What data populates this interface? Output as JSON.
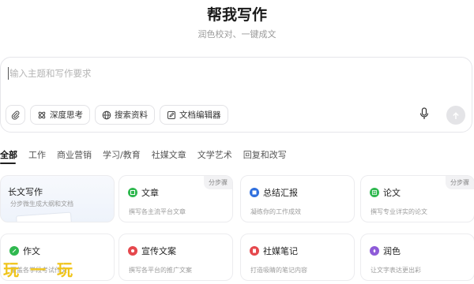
{
  "header": {
    "title": "帮我写作",
    "subtitle": "润色校对、一键成文"
  },
  "composer": {
    "placeholder": "输入主题和写作要求",
    "tools": [
      {
        "icon": "attachment-icon",
        "label": ""
      },
      {
        "icon": "deep-think-icon",
        "label": "深度思考"
      },
      {
        "icon": "globe-icon",
        "label": "搜索资料"
      },
      {
        "icon": "edit-document-icon",
        "label": "文档编辑器"
      }
    ],
    "mic_icon": "microphone-icon",
    "send_icon": "arrow-up-icon"
  },
  "tabs": [
    "全部",
    "工作",
    "商业营销",
    "学习/教育",
    "社媒文章",
    "文学艺术",
    "回复和改写"
  ],
  "cards": [
    {
      "title": "长文写作",
      "desc": "分步微生成大纲和文档",
      "tag": "",
      "icon": "",
      "color": ""
    },
    {
      "title": "文章",
      "desc": "撰写各主流平台文章",
      "tag": "分步骤",
      "icon": "article-icon",
      "color": "#2fb84f"
    },
    {
      "title": "总结汇报",
      "desc": "凝练你的工作成效",
      "tag": "",
      "icon": "report-icon",
      "color": "#2f6fde"
    },
    {
      "title": "论文",
      "desc": "撰写专业详实的论文",
      "tag": "分步骤",
      "icon": "paper-icon",
      "color": "#2fb84f"
    },
    {
      "title": "作文",
      "desc": "覆盖各学段考试作文",
      "tag": "",
      "icon": "essay-icon",
      "color": "#2fb84f"
    },
    {
      "title": "宣传文案",
      "desc": "撰写各平台的推广文案",
      "tag": "",
      "icon": "promo-icon",
      "color": "#e5484d"
    },
    {
      "title": "社媒笔记",
      "desc": "打造吸睛的笔记内容",
      "tag": "",
      "icon": "note-icon",
      "color": "#e5484d"
    },
    {
      "title": "润色",
      "desc": "让文字表达更出彩",
      "tag": "",
      "icon": "polish-icon",
      "color": "#8e5bd8"
    }
  ],
  "watermark": "玩一玩"
}
